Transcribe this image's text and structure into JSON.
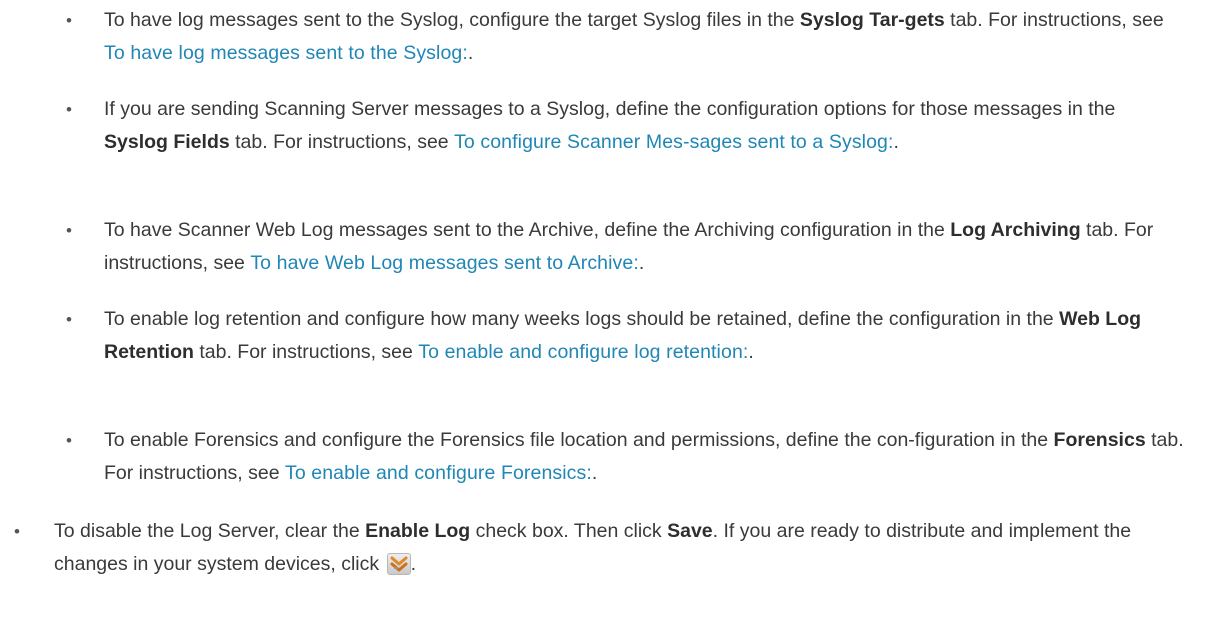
{
  "bullet_char": "•",
  "items": [
    {
      "t1": "To have log messages sent to the Syslog, configure the target Syslog files in the ",
      "b1": "Syslog Tar-gets",
      "t2": " tab. For instructions, see ",
      "link": "To have log messages sent to the Syslog:",
      "t3": "."
    },
    {
      "t1": "If you are sending Scanning Server messages to a Syslog, define the configuration options for those messages in the ",
      "b1": "Syslog Fields",
      "t2": " tab. For instructions, see ",
      "link": "To configure Scanner Mes-sages sent to a Syslog:",
      "t3": "."
    },
    {
      "t1": "To have Scanner Web Log messages sent to the Archive, define the Archiving configuration in the ",
      "b1": "Log Archiving",
      "t2": " tab. For instructions, see ",
      "link": "To have Web Log messages sent to Archive:",
      "t3": "."
    },
    {
      "t1": "To enable log retention and configure how many weeks logs should be retained, define the configuration in the ",
      "b1": "Web Log Retention",
      "t2": " tab. For instructions, see ",
      "link": "To enable and configure log retention:",
      "t3": "."
    },
    {
      "t1": "To enable Forensics and configure the Forensics file location and permissions, define the con-figuration in the ",
      "b1": "Forensics",
      "t2": " tab. For instructions, see ",
      "link": "To enable and configure Forensics:",
      "t3": "."
    }
  ],
  "final_item": {
    "t1": "To disable the Log Server, clear the ",
    "b1": "Enable Log",
    "t2": " check box. Then click ",
    "b2": "Save",
    "t3": ". If you are ready to distribute and implement the changes in your system devices, click ",
    "icon": "deploy-icon",
    "t4": "."
  },
  "colors": {
    "text": "#3a3a3a",
    "link": "#1f86b5"
  }
}
